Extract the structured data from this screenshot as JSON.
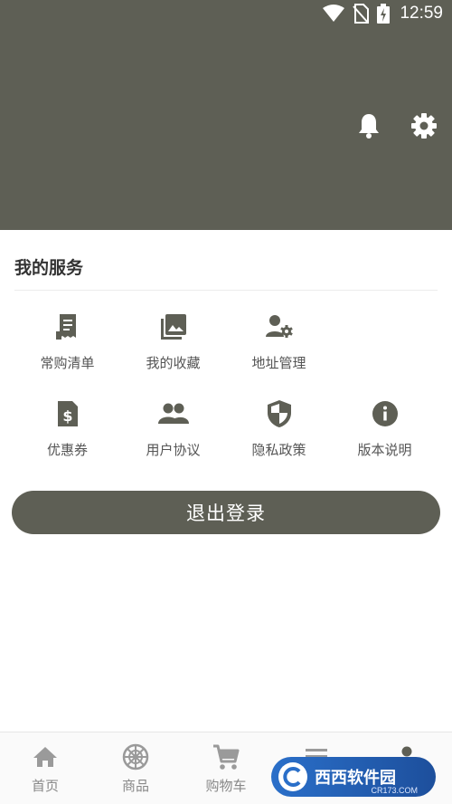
{
  "status_bar": {
    "time": "12:59"
  },
  "header": {
    "icons": [
      "bell-icon",
      "gear-icon"
    ]
  },
  "services": {
    "title": "我的服务",
    "items": [
      {
        "label": "常购清单",
        "icon": "receipt-icon"
      },
      {
        "label": "我的收藏",
        "icon": "image-collection-icon"
      },
      {
        "label": "地址管理",
        "icon": "user-settings-icon"
      },
      {
        "label": "优惠券",
        "icon": "coupon-icon"
      },
      {
        "label": "用户协议",
        "icon": "people-icon"
      },
      {
        "label": "隐私政策",
        "icon": "shield-icon"
      },
      {
        "label": "版本说明",
        "icon": "info-icon"
      }
    ]
  },
  "logout_label": "退出登录",
  "tabbar": {
    "tabs": [
      {
        "label": "首页",
        "icon": "home-icon"
      },
      {
        "label": "商品",
        "icon": "wheel-icon"
      },
      {
        "label": "购物车",
        "icon": "cart-icon"
      },
      {
        "label": "",
        "icon": "list-icon"
      },
      {
        "label": "",
        "icon": "person-icon"
      }
    ]
  },
  "watermark": {
    "text": "西西软件园",
    "sub": "CR173.COM"
  },
  "colors": {
    "primary": "#5e5f55",
    "icon": "#5e5f55",
    "tab_icon": "#9a9a9a"
  }
}
